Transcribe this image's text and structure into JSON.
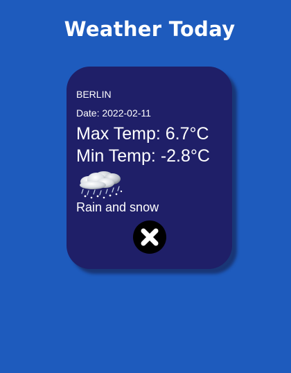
{
  "header": {
    "title": "Weather Today"
  },
  "card": {
    "city": "BERLIN",
    "date_label": "Date: ",
    "date": "2022-02-11",
    "max_temp_label": "Max Temp: ",
    "max_temp": "6.7°C",
    "min_temp_label": "Min Temp: ",
    "min_temp": "-2.8°C",
    "weather_icon": "rain-snow-cloud-icon",
    "description": "Rain and snow",
    "close_icon": "close-icon"
  },
  "colors": {
    "background": "#1e5bbd",
    "card": "#1f1f68",
    "text": "#ffffff",
    "close_button": "#000000"
  }
}
